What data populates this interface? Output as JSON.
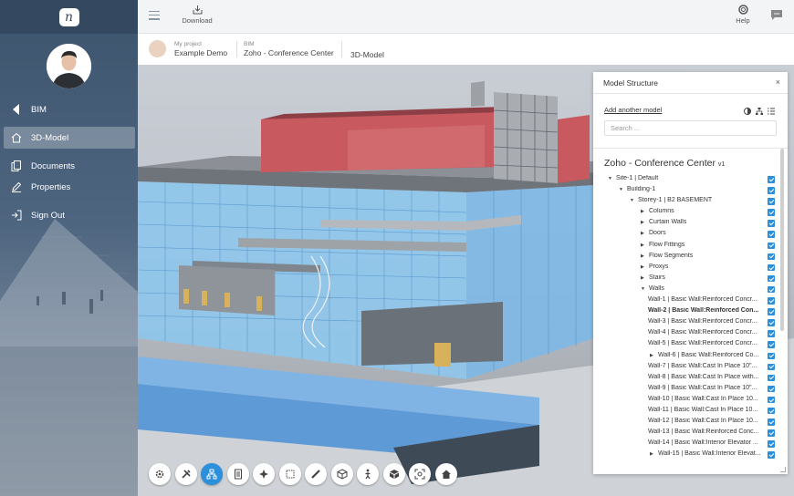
{
  "sidebar": {
    "logo_text": "n",
    "nav": [
      {
        "label": "BIM",
        "icon": "chevron-left-icon"
      },
      {
        "label": "3D-Model",
        "icon": "home-icon"
      },
      {
        "label": "Documents",
        "icon": "documents-icon"
      },
      {
        "label": "Properties",
        "icon": "pencil-icon"
      },
      {
        "label": "Sign Out",
        "icon": "sign-out-icon"
      }
    ]
  },
  "topbar": {
    "download_label": "Download",
    "help_label": "Help"
  },
  "breadcrumb": {
    "project_small": "My project",
    "project_main": "Example Demo",
    "bim_small": "BIM",
    "bim_main": "Zoho - Conference Center",
    "page_main": "3D-Model"
  },
  "panel": {
    "title": "Model Structure",
    "close": "×",
    "add_model": "Add another model",
    "search_placeholder": "Search ...",
    "model_title": "Zoho - Conference Center",
    "model_version": "v1",
    "tree": [
      {
        "label": "Site-1 | Default",
        "depth": 0,
        "arrow": "down"
      },
      {
        "label": "Building-1",
        "depth": 1,
        "arrow": "down"
      },
      {
        "label": "Storey-1 | B2 BASEMENT",
        "depth": 2,
        "arrow": "down"
      },
      {
        "label": "Columns",
        "depth": 3,
        "arrow": "right"
      },
      {
        "label": "Curtain Walls",
        "depth": 3,
        "arrow": "right"
      },
      {
        "label": "Doors",
        "depth": 3,
        "arrow": "right"
      },
      {
        "label": "Flow Fittings",
        "depth": 3,
        "arrow": "right"
      },
      {
        "label": "Flow Segments",
        "depth": 3,
        "arrow": "right"
      },
      {
        "label": "Proxys",
        "depth": 3,
        "arrow": "right"
      },
      {
        "label": "Stairs",
        "depth": 3,
        "arrow": "right"
      },
      {
        "label": "Walls",
        "depth": 3,
        "arrow": "down"
      },
      {
        "label": "Wall-1 | Basic Wall:Reinforced Concr...",
        "depth": 4,
        "arrow": ""
      },
      {
        "label": "Wall-2 | Basic Wall:Reinforced Con...",
        "depth": 4,
        "arrow": "",
        "bold": true
      },
      {
        "label": "Wall-3 | Basic Wall:Reinforced Concr...",
        "depth": 4,
        "arrow": ""
      },
      {
        "label": "Wall-4 | Basic Wall:Reinforced Concr...",
        "depth": 4,
        "arrow": ""
      },
      {
        "label": "Wall-5 | Basic Wall:Reinforced Concr...",
        "depth": 4,
        "arrow": ""
      },
      {
        "label": "Wall-6 | Basic Wall:Reinforced Co...",
        "depth": 4,
        "arrow": "right",
        "nested": true
      },
      {
        "label": "Wall-7 | Basic Wall:Cast In Place 10\"...",
        "depth": 4,
        "arrow": ""
      },
      {
        "label": "Wall-8 | Basic Wall:Cast In Place with...",
        "depth": 4,
        "arrow": ""
      },
      {
        "label": "Wall-9 | Basic Wall:Cast In Place 10\"...",
        "depth": 4,
        "arrow": ""
      },
      {
        "label": "Wall-10 | Basic Wall:Cast In Place 10...",
        "depth": 4,
        "arrow": ""
      },
      {
        "label": "Wall-11 | Basic Wall:Cast In Place 10...",
        "depth": 4,
        "arrow": ""
      },
      {
        "label": "Wall-12 | Basic Wall:Cast In Place 10...",
        "depth": 4,
        "arrow": ""
      },
      {
        "label": "Wall-13 | Basic Wall:Reinforced Conc...",
        "depth": 4,
        "arrow": ""
      },
      {
        "label": "Wall-14 | Basic Wall:Interior Elevator ...",
        "depth": 4,
        "arrow": ""
      },
      {
        "label": "Wall-15 | Basic Wall:Interior Elevat...",
        "depth": 4,
        "arrow": "right",
        "nested": true
      }
    ]
  },
  "toolbar": {
    "tools": [
      "settings-icon",
      "tools-icon",
      "model-structure-icon",
      "properties-icon",
      "navigate-icon",
      "section-box-icon",
      "measure-icon",
      "explode-icon",
      "first-person-icon",
      "cube-views-icon",
      "fit-view-icon",
      "home-view-icon"
    ],
    "active": "model-structure-icon"
  },
  "colors": {
    "accent": "#2b8fdc",
    "sidebar": "#3d546d",
    "facade_red": "#c85a5f"
  }
}
